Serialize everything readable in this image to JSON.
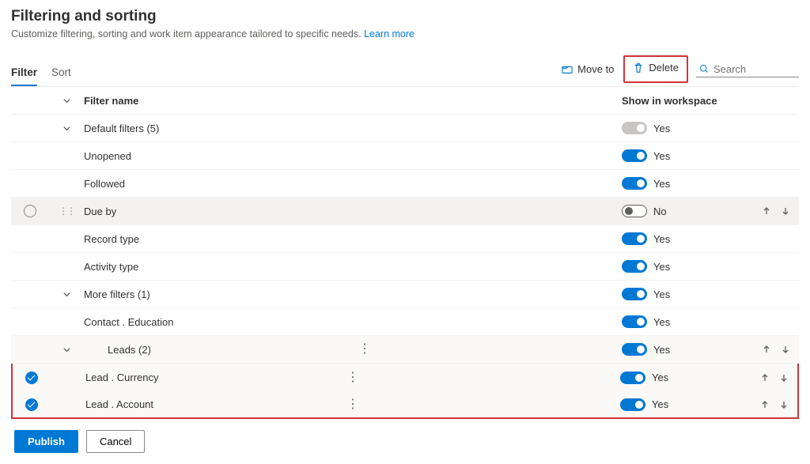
{
  "header": {
    "title": "Filtering and sorting",
    "subtitle": "Customize filtering, sorting and work item appearance tailored to specific needs.",
    "learn_more": "Learn more"
  },
  "tabs": {
    "filter": "Filter",
    "sort": "Sort"
  },
  "toolbar": {
    "move_to": "Move to",
    "delete": "Delete",
    "search_placeholder": "Search"
  },
  "columns": {
    "filter_name": "Filter name",
    "show_in_workspace": "Show in workspace"
  },
  "rows": {
    "default_filters": "Default filters (5)",
    "unopened": "Unopened",
    "followed": "Followed",
    "due_by": "Due by",
    "record_type": "Record type",
    "activity_type": "Activity type",
    "more_filters": "More filters (1)",
    "contact_education": "Contact . Education",
    "leads": "Leads (2)",
    "lead_currency": "Lead . Currency",
    "lead_account": "Lead . Account"
  },
  "toggle_labels": {
    "yes": "Yes",
    "no": "No"
  },
  "footer": {
    "publish": "Publish",
    "cancel": "Cancel"
  }
}
